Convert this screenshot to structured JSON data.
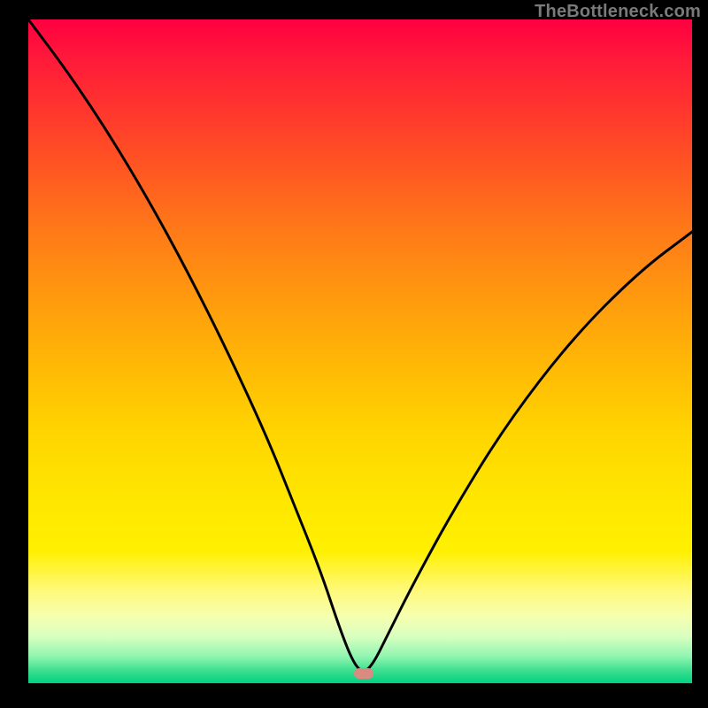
{
  "watermark": {
    "text": "TheBottleneck.com"
  },
  "chart_data": {
    "type": "line",
    "title": "",
    "xlabel": "",
    "ylabel": "",
    "xlim": [
      0,
      100
    ],
    "ylim": [
      0,
      100
    ],
    "grid": false,
    "legend": false,
    "series": [
      {
        "name": "bottleneck-curve",
        "x": [
          0,
          6,
          12,
          18,
          24,
          30,
          36,
          40,
          44,
          47,
          49,
          50.5,
          52,
          54,
          58,
          64,
          72,
          82,
          92,
          100
        ],
        "values": [
          100,
          92,
          83,
          73,
          62,
          50,
          37,
          27,
          17,
          8,
          3,
          1.5,
          3,
          7,
          15,
          26,
          39,
          52,
          62,
          68
        ]
      }
    ],
    "marker": {
      "x": 50.5,
      "y": 1.5,
      "color": "#d98b82"
    },
    "background_gradient": {
      "top": "#ff0040",
      "mid": "#ffe600",
      "bottom": "#00d080"
    }
  }
}
